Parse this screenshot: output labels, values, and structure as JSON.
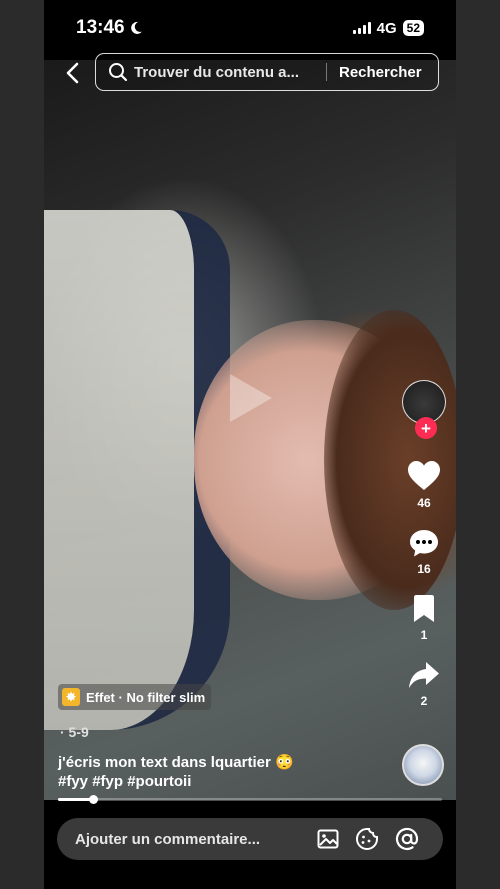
{
  "status_bar": {
    "time": "13:46",
    "network": "4G",
    "battery": "52"
  },
  "search": {
    "placeholder": "Trouver du contenu a...",
    "button_label": "Rechercher"
  },
  "actions": {
    "likes": "46",
    "comments": "16",
    "saves": "1",
    "shares": "2"
  },
  "effect": {
    "label": "Effet · No filter slim"
  },
  "post": {
    "date": "· 5-9",
    "caption": "j'écris mon text dans lquartier 😳",
    "hashtags": "#fyy #fyp #pourtoii"
  },
  "progress": {
    "fraction": 0.09
  },
  "comment_bar": {
    "placeholder": "Ajouter un commentaire..."
  },
  "colors": {
    "accent": "#fe2c55",
    "effect_icon": "#f3b62b"
  }
}
